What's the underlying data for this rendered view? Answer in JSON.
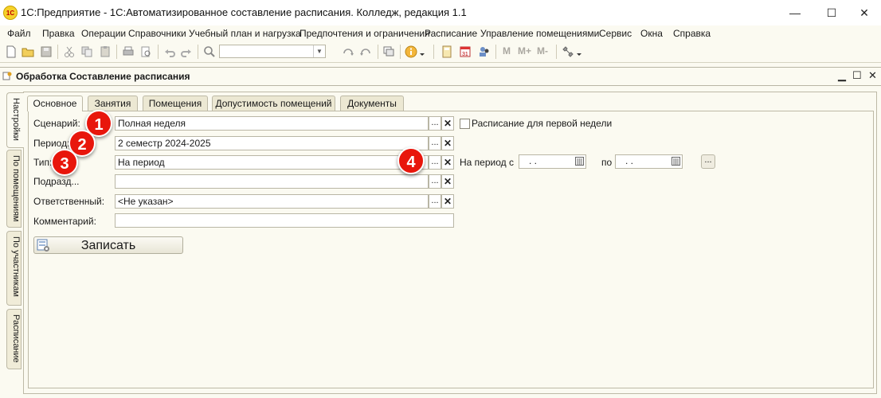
{
  "window": {
    "app_icon": "1С",
    "title": "1С:Предприятие - 1С:Автоматизированное составление расписания. Колледж, редакция 1.1",
    "minimize": "—",
    "maximize": "☐",
    "close": "✕"
  },
  "menu": {
    "items": [
      "Файл",
      "Правка",
      "Операции",
      "Справочники",
      "Учебный план и нагрузка",
      "Предпочтения и ограничения",
      "Расписание",
      "Управление помещениями",
      "Сервис",
      "Окна",
      "Справка"
    ]
  },
  "toolbar": {
    "search_value": "",
    "m_labels": [
      "M",
      "M+",
      "M-"
    ]
  },
  "subwindow": {
    "title": "Обработка  Составление расписания",
    "minimize": "▁",
    "maximize": "☐",
    "close": "✕"
  },
  "vertical_tabs": [
    "Настройки",
    "По помещениям",
    "По участникам",
    "Расписание"
  ],
  "tabs": [
    "Основное",
    "Занятия",
    "Помещения",
    "Допустимость помещений",
    "Документы"
  ],
  "form": {
    "scenario_label": "Сценарий:",
    "scenario_value": "Полная неделя",
    "first_week_label": "Расписание для первой недели",
    "period_label": "Период:",
    "period_value": "2 семестр 2024-2025",
    "type_label": "Тип:",
    "type_value": "На период",
    "period_from_label": "На период с",
    "date_from": ". .",
    "to_label": "по",
    "date_to": ". .",
    "dept_label": "Подразд...",
    "dept_value": "",
    "responsible_label": "Ответственный:",
    "responsible_value": "<Не указан>",
    "comment_label": "Комментарий:",
    "comment_value": "",
    "save_label": "Записать",
    "choose_btn": "...",
    "clear_btn": "✕"
  },
  "badges": [
    "1",
    "2",
    "3",
    "4"
  ],
  "colors": {
    "badge": "#e8160c",
    "background": "#fbfaf1"
  }
}
